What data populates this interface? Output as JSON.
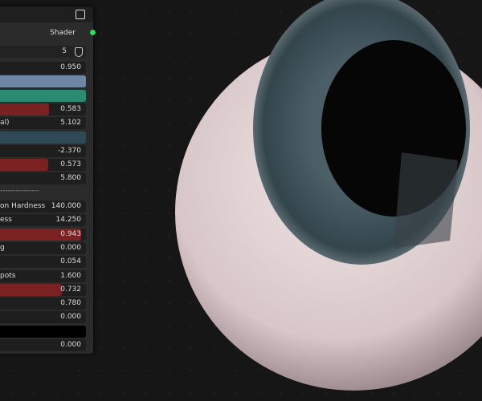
{
  "node": {
    "output_label": "Shader",
    "users": "5",
    "separator": "---------------",
    "rows": [
      {
        "kind": "value",
        "label": "",
        "value": "0.950"
      },
      {
        "kind": "color",
        "color": "#6f87a4"
      },
      {
        "kind": "color",
        "color": "#2a8a72"
      },
      {
        "kind": "slider",
        "label": "",
        "value": "0.583",
        "fill": 0.583
      },
      {
        "kind": "value",
        "label": "al)",
        "value": "5.102"
      },
      {
        "kind": "color",
        "color": "#2f4a55"
      },
      {
        "kind": "value",
        "label": "",
        "value": "-2.370"
      },
      {
        "kind": "slider",
        "label": "",
        "value": "0.573",
        "fill": 0.573
      },
      {
        "kind": "value",
        "label": "",
        "value": "5.800"
      },
      {
        "kind": "sep"
      },
      {
        "kind": "value",
        "label": "on Hardness",
        "value": "140.000"
      },
      {
        "kind": "value",
        "label": "ess",
        "value": "14.250"
      },
      {
        "kind": "slider",
        "label": "",
        "value": "0.943",
        "fill": 0.943
      },
      {
        "kind": "value",
        "label": "g",
        "value": "0.000"
      },
      {
        "kind": "value",
        "label": "",
        "value": "0.054"
      },
      {
        "kind": "value",
        "label": "pots",
        "value": "1.600"
      },
      {
        "kind": "slider",
        "label": "",
        "value": "0.732",
        "fill": 0.732
      },
      {
        "kind": "value",
        "label": "",
        "value": "0.780"
      },
      {
        "kind": "value",
        "label": "",
        "value": "0.000"
      },
      {
        "kind": "color",
        "color": "#000000"
      },
      {
        "kind": "value",
        "label": "",
        "value": "0.000"
      }
    ]
  }
}
